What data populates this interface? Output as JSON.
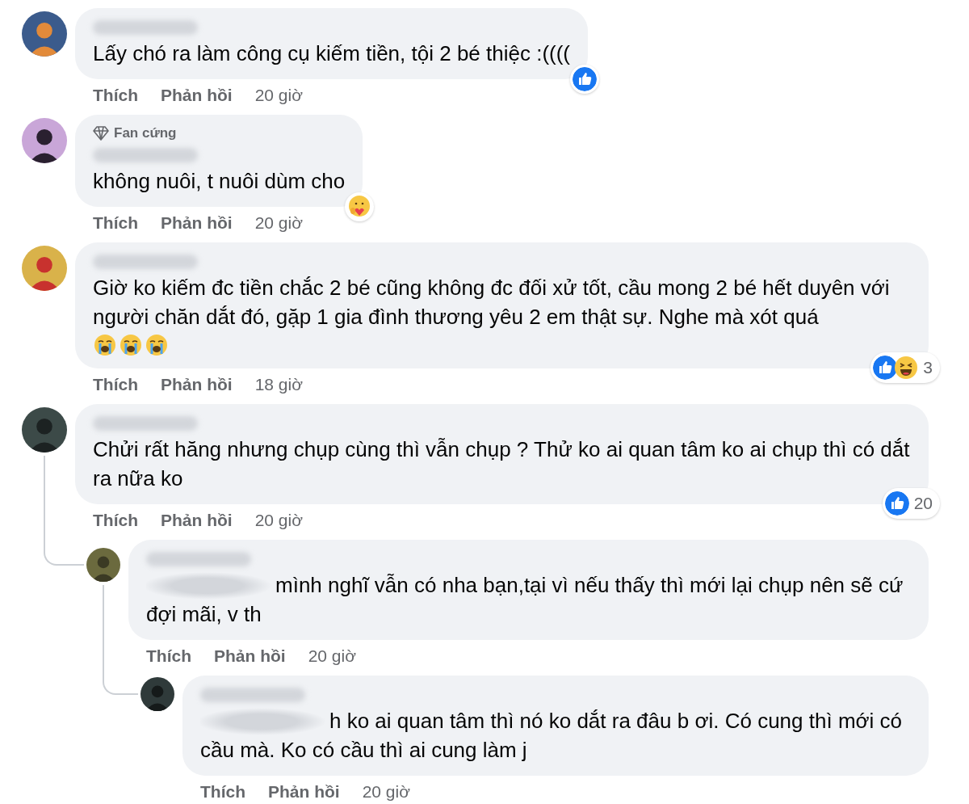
{
  "comments": [
    {
      "name_blurred": true,
      "body": "Lấy chó ra làm công cụ kiếm tiền, tội 2 bé thiệc :((((",
      "reactions": {
        "kinds": [
          {
            "kind": "like"
          }
        ]
      },
      "actions": {
        "like": "Thích",
        "reply": "Phản hồi",
        "time": "20 giờ"
      }
    },
    {
      "name_blurred": true,
      "badge": "Fan cứng",
      "body": "không nuôi, t nuôi dùm cho",
      "reactions": {
        "kinds": [
          {
            "kind": "care"
          }
        ]
      },
      "actions": {
        "like": "Thích",
        "reply": "Phản hồi",
        "time": "20 giờ"
      }
    },
    {
      "name_blurred": true,
      "body": "Giờ ko kiếm đc tiền chắc 2 bé cũng không đc đối xử tốt, cầu mong 2 bé hết duyên với người chăn dắt đó, gặp 1 gia đình thương yêu 2 em thật sự. Nghe mà xót quá",
      "emojis": [
        {
          "kind": "crying"
        },
        {
          "kind": "crying"
        },
        {
          "kind": "crying"
        }
      ],
      "reactions": {
        "kinds": [
          {
            "kind": "like"
          },
          {
            "kind": "haha"
          }
        ],
        "count": "3"
      },
      "actions": {
        "like": "Thích",
        "reply": "Phản hồi",
        "time": "18 giờ"
      }
    },
    {
      "name_blurred": true,
      "body": "Chửi rất hăng nhưng chụp cùng thì vẫn chụp ? Thử ko ai quan tâm ko ai chụp thì có dắt ra nữa ko",
      "reactions": {
        "kinds": [
          {
            "kind": "like"
          }
        ],
        "count": "20"
      },
      "actions": {
        "like": "Thích",
        "reply": "Phản hồi",
        "time": "20 giờ"
      },
      "children": [
        {
          "name_blurred": true,
          "mention_blurred": true,
          "body": "mình nghĩ vẫn có nha bạn,tại vì nếu thấy thì mới lại chụp nên sẽ cứ đợi mãi, v th",
          "actions": {
            "like": "Thích",
            "reply": "Phản hồi",
            "time": "20 giờ"
          },
          "children": [
            {
              "name_blurred": true,
              "mention_blurred": true,
              "body": "h ko ai quan tâm thì nó ko dắt ra đâu b ơi. Có cung thì mới có cầu mà. Ko có cầu thì ai cung làm j",
              "actions": {
                "like": "Thích",
                "reply": "Phản hồi",
                "time": "20 giờ"
              }
            }
          ]
        }
      ]
    }
  ]
}
